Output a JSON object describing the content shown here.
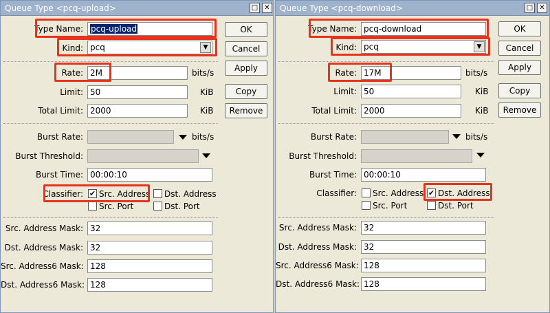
{
  "windows": [
    {
      "title": "Queue Type <pcq-upload>",
      "type_name": {
        "label": "Type Name:",
        "value": "pcq-upload"
      },
      "kind": {
        "label": "Kind:",
        "value": "pcq"
      },
      "rate": {
        "label": "Rate:",
        "value": "2M",
        "unit": "bits/s"
      },
      "limit": {
        "label": "Limit:",
        "value": "50",
        "unit": "KiB"
      },
      "total_limit": {
        "label": "Total Limit:",
        "value": "2000",
        "unit": "KiB"
      },
      "burst_rate": {
        "label": "Burst Rate:",
        "value": "",
        "unit": "bits/s"
      },
      "burst_threshold": {
        "label": "Burst Threshold:",
        "value": ""
      },
      "burst_time": {
        "label": "Burst Time:",
        "value": "00:00:10"
      },
      "classifier": {
        "label": "Classifier:",
        "src_address": {
          "label": "Src. Address",
          "checked": true
        },
        "dst_address": {
          "label": "Dst. Address",
          "checked": false
        },
        "src_port": {
          "label": "Src. Port",
          "checked": false
        },
        "dst_port": {
          "label": "Dst. Port",
          "checked": false
        }
      },
      "src_address_mask": {
        "label": "Src. Address Mask:",
        "value": "32"
      },
      "dst_address_mask": {
        "label": "Dst. Address Mask:",
        "value": "32"
      },
      "src_address6_mask": {
        "label": "Src. Address6 Mask:",
        "value": "128"
      },
      "dst_address6_mask": {
        "label": "Dst. Address6 Mask:",
        "value": "128"
      },
      "buttons": {
        "ok": "OK",
        "cancel": "Cancel",
        "apply": "Apply",
        "copy": "Copy",
        "remove": "Remove"
      }
    },
    {
      "title": "Queue Type <pcq-download>",
      "type_name": {
        "label": "Type Name:",
        "value": "pcq-download"
      },
      "kind": {
        "label": "Kind:",
        "value": "pcq"
      },
      "rate": {
        "label": "Rate:",
        "value": "17M",
        "unit": "bits/s"
      },
      "limit": {
        "label": "Limit:",
        "value": "50",
        "unit": "KiB"
      },
      "total_limit": {
        "label": "Total Limit:",
        "value": "2000",
        "unit": "KiB"
      },
      "burst_rate": {
        "label": "Burst Rate:",
        "value": "",
        "unit": "bits/s"
      },
      "burst_threshold": {
        "label": "Burst Threshold:",
        "value": ""
      },
      "burst_time": {
        "label": "Burst Time:",
        "value": "00:00:10"
      },
      "classifier": {
        "label": "Classifier:",
        "src_address": {
          "label": "Src. Address",
          "checked": false
        },
        "dst_address": {
          "label": "Dst. Address",
          "checked": true
        },
        "src_port": {
          "label": "Src. Port",
          "checked": false
        },
        "dst_port": {
          "label": "Dst. Port",
          "checked": false
        }
      },
      "src_address_mask": {
        "label": "Src. Address Mask:",
        "value": "32"
      },
      "dst_address_mask": {
        "label": "Dst. Address Mask:",
        "value": "32"
      },
      "src_address6_mask": {
        "label": "Src. Address6 Mask:",
        "value": "128"
      },
      "dst_address6_mask": {
        "label": "Dst. Address6 Mask:",
        "value": "128"
      },
      "buttons": {
        "ok": "OK",
        "cancel": "Cancel",
        "apply": "Apply",
        "copy": "Copy",
        "remove": "Remove"
      }
    }
  ],
  "icons": {
    "maximize": "maximize-icon",
    "close": "close-icon",
    "dropdown": "dropdown-arrow-icon",
    "check": "checkmark-icon"
  },
  "colors": {
    "highlight": "#e8321c",
    "titlebar": "#9fb2cc",
    "selection": "#0a246a"
  }
}
